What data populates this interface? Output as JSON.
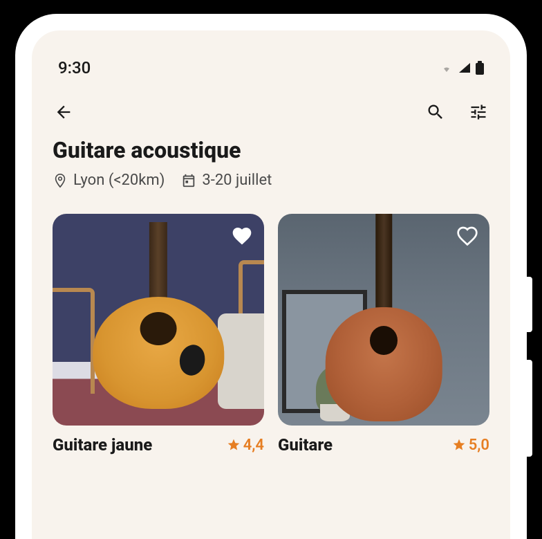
{
  "status_bar": {
    "time": "9:30"
  },
  "header": {
    "title": "Guitare acoustique",
    "location": "Lyon (<20km)",
    "date_range": "3-20 juillet"
  },
  "listings": [
    {
      "title": "Guitare jaune",
      "rating": "4,4",
      "favorited": true
    },
    {
      "title": "Guitare",
      "rating": "5,0",
      "favorited": false
    }
  ],
  "colors": {
    "accent": "#e67e22",
    "background": "#f8f3ed",
    "text_primary": "#1a1a1a",
    "text_secondary": "#4a4a4a"
  }
}
